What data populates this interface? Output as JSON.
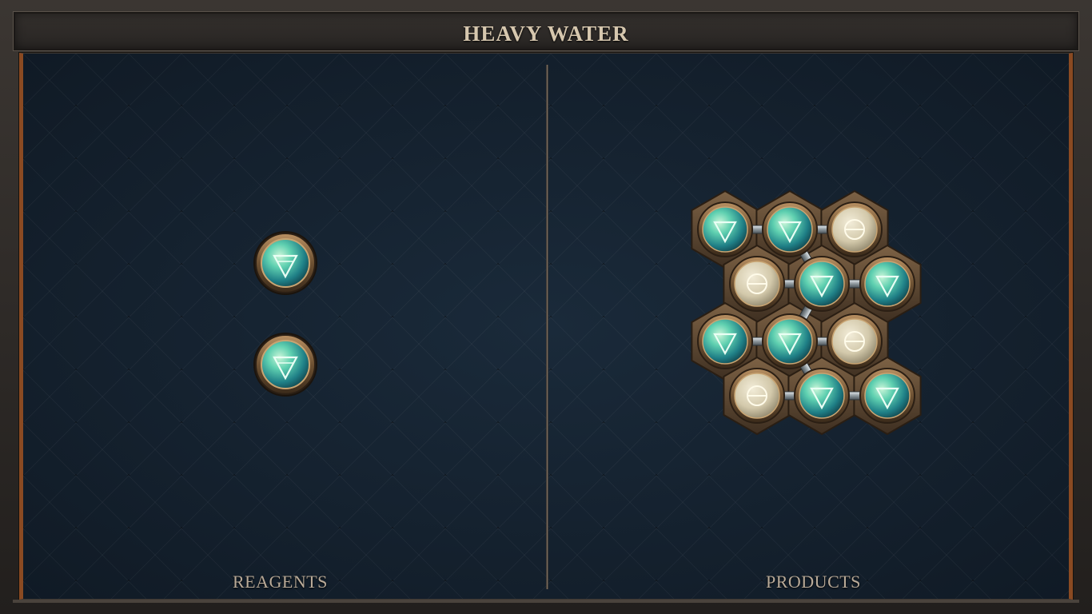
{
  "title": "HEAVY WATER",
  "labels": {
    "reagents": "REAGENTS",
    "products": "PRODUCTS"
  },
  "colors": {
    "frame": "#2e2a27",
    "board": "#152230",
    "trim": "#8a4a22",
    "water_atom": "#3fb5a4",
    "salt_atom": "#d9d1b8",
    "bronze": "#8b6a45"
  },
  "atom_icons": {
    "water": "water-triangle-icon",
    "salt": "salt-theta-icon"
  }
}
